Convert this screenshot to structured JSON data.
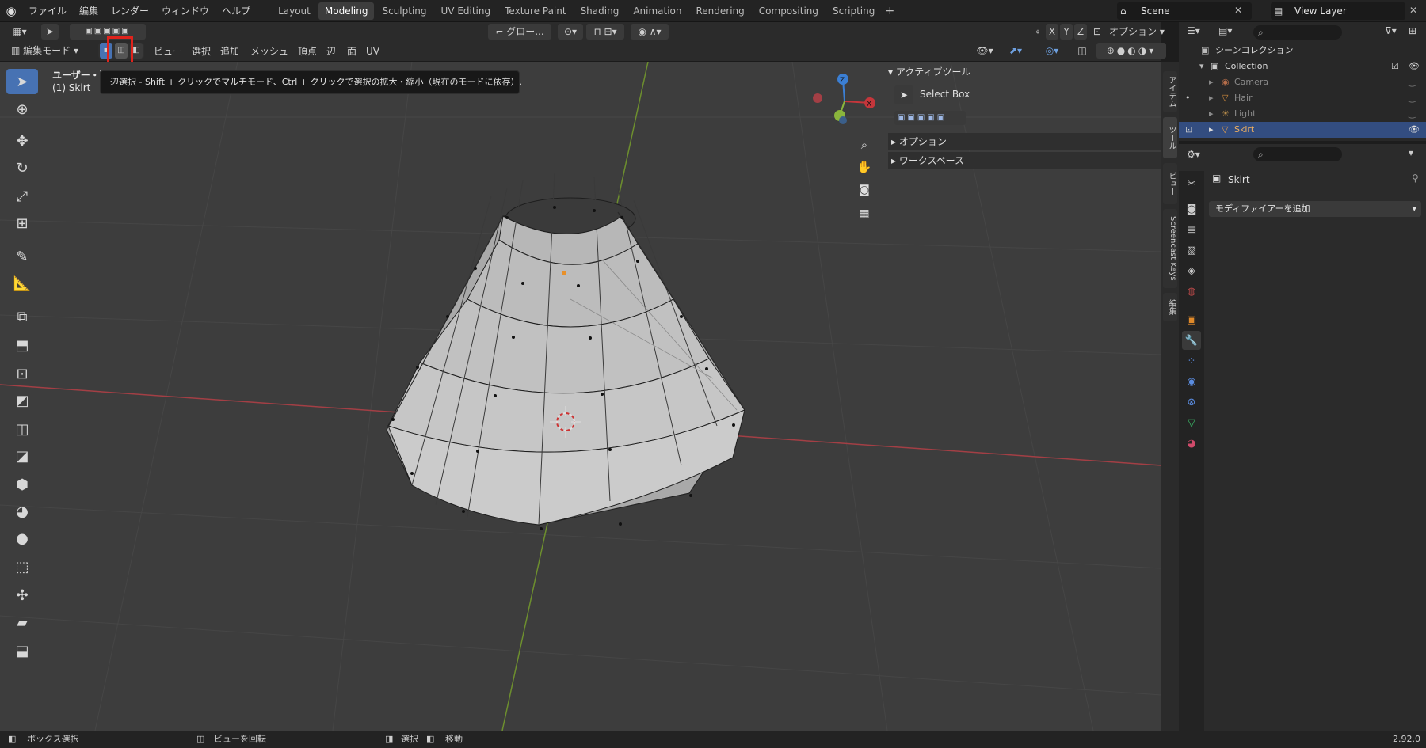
{
  "topbar": {
    "menus": [
      "ファイル",
      "編集",
      "レンダー",
      "ウィンドウ",
      "ヘルプ"
    ],
    "workspace_tabs": [
      "Layout",
      "Modeling",
      "Sculpting",
      "UV Editing",
      "Texture Paint",
      "Shading",
      "Animation",
      "Rendering",
      "Compositing",
      "Scripting"
    ],
    "active_tab": "Modeling",
    "scene": "Scene",
    "view_layer": "View Layer"
  },
  "header": {
    "transform_orientation": "グロー...",
    "axis_x": "X",
    "axis_y": "Y",
    "axis_z": "Z",
    "options": "オプション",
    "mode": "編集モード",
    "menus": [
      "ビュー",
      "選択",
      "追加",
      "メッシュ",
      "頂点",
      "辺",
      "面",
      "UV"
    ]
  },
  "viewport": {
    "view_name": "ユーザー・透",
    "object_label": "(1) Skirt",
    "tooltip": "辺選択 - Shift + クリックでマルチモード、Ctrl + クリックで選択の拡大・縮小（現在のモードに依存）.",
    "gizmo": {
      "x": "X",
      "y": "Y",
      "z": "Z"
    }
  },
  "npanel": {
    "active_tool_header": "アクティブツール",
    "tool_name": "Select Box",
    "options_header": "オプション",
    "workspace_header": "ワークスペース",
    "tabs": [
      "アイテム",
      "ツール",
      "ビュー",
      "Screencast Keys",
      "編集"
    ]
  },
  "outliner": {
    "scene_collection": "シーンコレクション",
    "collection": "Collection",
    "items": [
      "Camera",
      "Hair",
      "Light",
      "Skirt"
    ],
    "selected": "Skirt"
  },
  "properties": {
    "object_name": "Skirt",
    "add_modifier": "モディファイアーを追加"
  },
  "statusbar": {
    "left": "ボックス選択",
    "mid": "ビューを回転",
    "select": "選択",
    "move": "移動",
    "version": "2.92.0"
  },
  "colors": {
    "accent": "#4772b3",
    "highlight_red": "#e0231c",
    "x_axis": "#c5363b",
    "y_axis": "#8ab53c",
    "z_axis": "#3b7fd4",
    "selected_row": "#334d80"
  }
}
